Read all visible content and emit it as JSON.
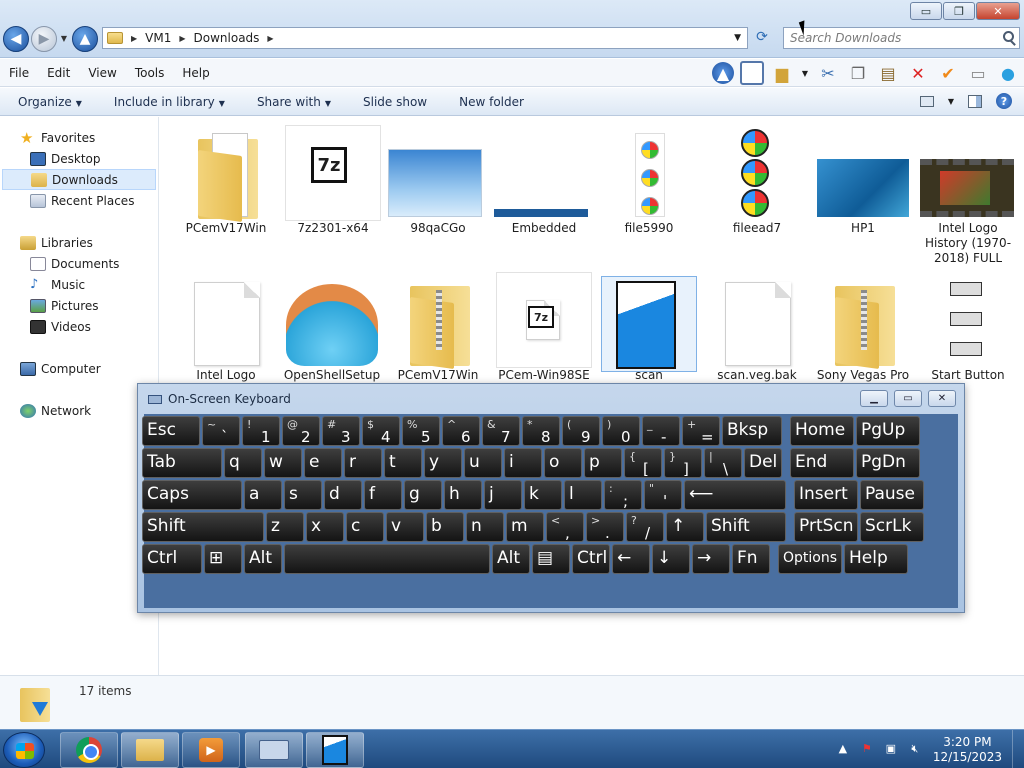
{
  "window": {
    "minimize": "▭",
    "maximize": "❐",
    "close": "✕"
  },
  "address": {
    "segments": [
      "VM1",
      "Downloads"
    ],
    "search_placeholder": "Search Downloads"
  },
  "menu": [
    "File",
    "Edit",
    "View",
    "Tools",
    "Help"
  ],
  "commands": [
    {
      "label": "Organize",
      "dropdown": true
    },
    {
      "label": "Include in library",
      "dropdown": true
    },
    {
      "label": "Share with",
      "dropdown": true
    },
    {
      "label": "Slide show",
      "dropdown": false
    },
    {
      "label": "New folder",
      "dropdown": false
    }
  ],
  "nav": {
    "favorites": "Favorites",
    "favorites_items": [
      "Desktop",
      "Downloads",
      "Recent Places"
    ],
    "libraries": "Libraries",
    "libraries_items": [
      "Documents",
      "Music",
      "Pictures",
      "Videos"
    ],
    "computer": "Computer",
    "network": "Network"
  },
  "files": [
    {
      "label": "PCemV17Win",
      "icon": "folder-icon"
    },
    {
      "label": "7z2301-x64",
      "icon": "7zip-installer-icon"
    },
    {
      "label": "98qaCGo",
      "icon": "image-thumbnail"
    },
    {
      "label": "Embedded",
      "icon": "image-thumbnail"
    },
    {
      "label": "file5990",
      "icon": "windows-logo-icon"
    },
    {
      "label": "fileead7",
      "icon": "windows-orb-icon"
    },
    {
      "label": "HP1",
      "icon": "image-thumbnail"
    },
    {
      "label": "Intel Logo History (1970-2018) FULL",
      "icon": "video-thumbnail"
    },
    {
      "label": "Intel Logo",
      "icon": "blank-file-icon"
    },
    {
      "label": "OpenShellSetup",
      "icon": "shell-icon"
    },
    {
      "label": "PCemV17Win",
      "icon": "zip-folder-icon"
    },
    {
      "label": "PCem-Win98SE",
      "icon": "7z-archive-icon"
    },
    {
      "label": "scan",
      "icon": "vegas-project-icon"
    },
    {
      "label": "scan.veg.bak",
      "icon": "blank-file-icon"
    },
    {
      "label": "Sony Vegas Pro",
      "icon": "zip-folder-icon"
    },
    {
      "label": "Start Button",
      "icon": "start-button-icon"
    }
  ],
  "osk": {
    "title": "On-Screen Keyboard",
    "row1": [
      {
        "k": "Esc"
      },
      {
        "sub": "~",
        "k": "`"
      },
      {
        "sub": "!",
        "k": "1"
      },
      {
        "sub": "@",
        "k": "2"
      },
      {
        "sub": "#",
        "k": "3"
      },
      {
        "sub": "$",
        "k": "4"
      },
      {
        "sub": "%",
        "k": "5"
      },
      {
        "sub": "^",
        "k": "6"
      },
      {
        "sub": "&",
        "k": "7"
      },
      {
        "sub": "*",
        "k": "8"
      },
      {
        "sub": "(",
        "k": "9"
      },
      {
        "sub": ")",
        "k": "0"
      },
      {
        "sub": "_",
        "k": "-"
      },
      {
        "sub": "+",
        "k": "="
      },
      {
        "k": "Bksp"
      },
      {
        "k": "Home"
      },
      {
        "k": "PgUp"
      }
    ],
    "row2": [
      {
        "k": "Tab"
      },
      {
        "k": "q"
      },
      {
        "k": "w"
      },
      {
        "k": "e"
      },
      {
        "k": "r"
      },
      {
        "k": "t"
      },
      {
        "k": "y"
      },
      {
        "k": "u"
      },
      {
        "k": "i"
      },
      {
        "k": "o"
      },
      {
        "k": "p"
      },
      {
        "sub": "{",
        "k": "["
      },
      {
        "sub": "}",
        "k": "]"
      },
      {
        "sub": "|",
        "k": "\\"
      },
      {
        "k": "Del"
      },
      {
        "k": "End"
      },
      {
        "k": "PgDn"
      }
    ],
    "row3": [
      {
        "k": "Caps"
      },
      {
        "k": "a"
      },
      {
        "k": "s"
      },
      {
        "k": "d"
      },
      {
        "k": "f"
      },
      {
        "k": "g"
      },
      {
        "k": "h"
      },
      {
        "k": "j"
      },
      {
        "k": "k"
      },
      {
        "k": "l"
      },
      {
        "sub": ":",
        "k": ";"
      },
      {
        "sub": "\"",
        "k": "'"
      },
      {
        "k": "⟵"
      },
      {
        "k": "Insert"
      },
      {
        "k": "Pause"
      }
    ],
    "row4": [
      {
        "k": "Shift"
      },
      {
        "k": "z"
      },
      {
        "k": "x"
      },
      {
        "k": "c"
      },
      {
        "k": "v"
      },
      {
        "k": "b"
      },
      {
        "k": "n"
      },
      {
        "k": "m"
      },
      {
        "sub": "<",
        "k": ","
      },
      {
        "sub": ">",
        "k": "."
      },
      {
        "sub": "?",
        "k": "/"
      },
      {
        "k": "↑"
      },
      {
        "k": "Shift"
      },
      {
        "k": "PrtScn"
      },
      {
        "k": "ScrLk"
      }
    ],
    "row5": [
      {
        "k": "Ctrl"
      },
      {
        "k": "⊞"
      },
      {
        "k": "Alt"
      },
      {
        "k": ""
      },
      {
        "k": "Alt"
      },
      {
        "k": "▤"
      },
      {
        "k": "Ctrl"
      },
      {
        "k": "←"
      },
      {
        "k": "↓"
      },
      {
        "k": "→"
      },
      {
        "k": "Fn"
      },
      {
        "k": "Options"
      },
      {
        "k": "Help"
      }
    ]
  },
  "status": {
    "item_count": "17 items"
  },
  "clock": {
    "time": "3:20 PM",
    "date": "12/15/2023"
  }
}
